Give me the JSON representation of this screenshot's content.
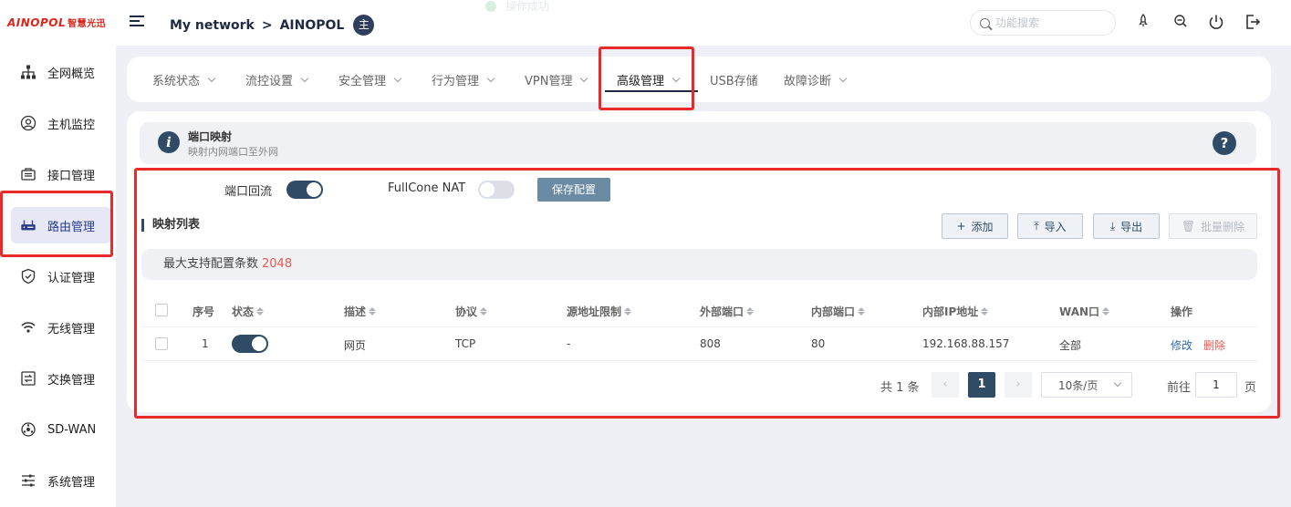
{
  "header": {
    "logo_brand": "AINOPOL",
    "logo_cn": "智慧光迅",
    "breadcrumb": {
      "root": "My network",
      "separator": ">",
      "current": "AINOPOL",
      "avatar_text": "主"
    },
    "toast": "操作成功",
    "search": {
      "placeholder": "功能搜索",
      "value": ""
    }
  },
  "sidebar": {
    "items": [
      {
        "label": "全网概览",
        "icon": "network-topology-icon"
      },
      {
        "label": "主机监控",
        "icon": "user-circle-icon"
      },
      {
        "label": "接口管理",
        "icon": "interface-icon"
      },
      {
        "label": "路由管理",
        "icon": "router-icon",
        "active": true
      },
      {
        "label": "认证管理",
        "icon": "shield-icon"
      },
      {
        "label": "无线管理",
        "icon": "wifi-icon"
      },
      {
        "label": "交换管理",
        "icon": "switch-icon"
      },
      {
        "label": "SD-WAN",
        "icon": "sdwan-icon"
      },
      {
        "label": "系统管理",
        "icon": "sliders-icon"
      }
    ]
  },
  "tabs": {
    "items": [
      {
        "label": "系统状态",
        "has_dropdown": true
      },
      {
        "label": "流控设置",
        "has_dropdown": true
      },
      {
        "label": "安全管理",
        "has_dropdown": true
      },
      {
        "label": "行为管理",
        "has_dropdown": true
      },
      {
        "label": "VPN管理",
        "has_dropdown": true
      },
      {
        "label": "高级管理",
        "has_dropdown": true,
        "active": true
      },
      {
        "label": "USB存储",
        "has_dropdown": false
      },
      {
        "label": "故障诊断",
        "has_dropdown": true
      }
    ]
  },
  "info": {
    "title": "端口映射",
    "subtitle": "映射内网端口至外网",
    "icon_glyph": "i",
    "help_glyph": "?"
  },
  "settings": {
    "loopback": {
      "label": "端口回流",
      "on": true
    },
    "fullcone": {
      "label": "FullCone NAT",
      "on": false
    },
    "save_label": "保存配置"
  },
  "list": {
    "title": "映射列表",
    "actions": {
      "add": "添加",
      "import": "导入",
      "export": "导出",
      "batch_delete": "批量删除"
    },
    "limit_text": "最大支持配置条数",
    "limit_value": "2048",
    "columns": [
      "序号",
      "状态",
      "描述",
      "协议",
      "源地址限制",
      "外部端口",
      "内部端口",
      "内部IP地址",
      "WAN口",
      "操作"
    ],
    "rows": [
      {
        "index": "1",
        "status_on": true,
        "desc": "网页",
        "protocol": "TCP",
        "src_limit": "-",
        "ext_port": "808",
        "int_port": "80",
        "int_ip": "192.168.88.157",
        "wan": "全部",
        "edit": "修改",
        "delete": "删除"
      }
    ]
  },
  "pagination": {
    "total_text": "共 1 条",
    "prev": "‹",
    "current_page": "1",
    "next": "›",
    "page_size": "10条/页",
    "goto_label": "前往",
    "goto_value": "1",
    "goto_suffix": "页"
  },
  "colors": {
    "accent": "#2f4b66",
    "annotation": "#ea2a2a",
    "danger": "#e85a4f",
    "brand": "#d9261c"
  }
}
